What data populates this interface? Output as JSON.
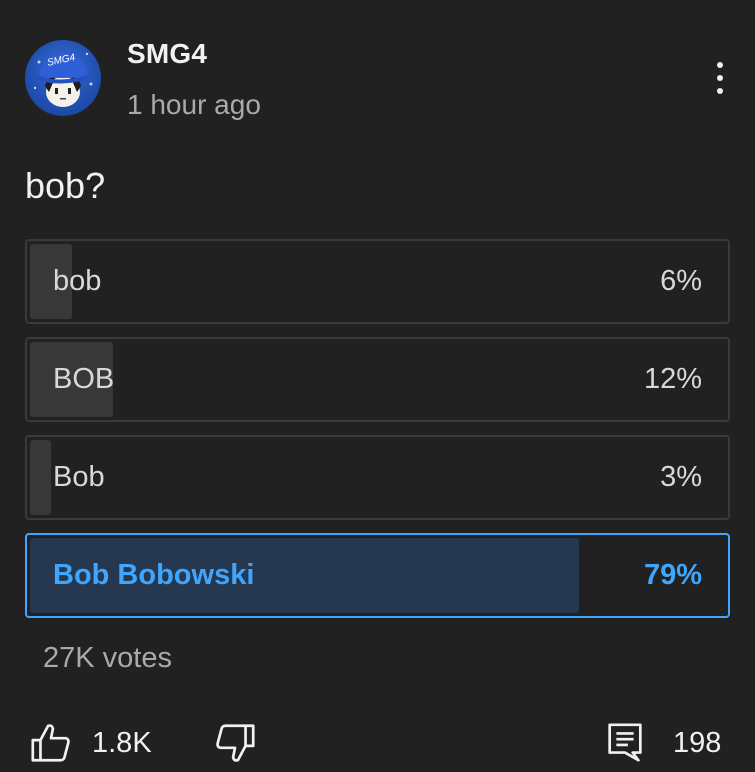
{
  "post": {
    "channel_name": "SMG4",
    "timestamp": "1 hour ago",
    "avatar_icon": "smg4-avatar-icon",
    "avatar_text": "SMG4",
    "menu_icon": "more-vert-icon",
    "text": "bob?"
  },
  "poll": {
    "options": [
      {
        "label": "bob",
        "percent_text": "6%",
        "percent": 6,
        "selected": false
      },
      {
        "label": "BOB",
        "percent_text": "12%",
        "percent": 12,
        "selected": false
      },
      {
        "label": "Bob",
        "percent_text": "3%",
        "percent": 3,
        "selected": false
      },
      {
        "label": "Bob Bobowski",
        "percent_text": "79%",
        "percent": 79,
        "selected": true
      }
    ],
    "vote_count": "27K votes"
  },
  "actions": {
    "like_icon": "thumbs-up-icon",
    "like_count": "1.8K",
    "dislike_icon": "thumbs-down-icon",
    "comment_icon": "comment-icon",
    "comment_count": "198"
  },
  "colors": {
    "background": "#212121",
    "accent": "#3ea6ff",
    "selected_fill": "#263850",
    "unselected_fill": "#383838"
  }
}
